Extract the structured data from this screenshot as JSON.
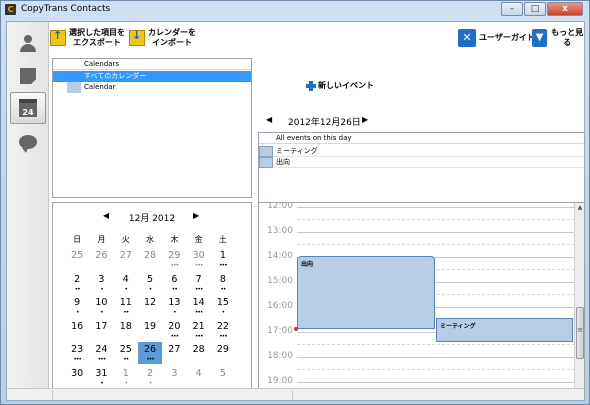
{
  "window": {
    "title": "CopyTrans Contacts",
    "app_icon": "C",
    "buttons": {
      "minimize": "–",
      "maximize": "□",
      "close": "x"
    }
  },
  "sidebar": {
    "items": [
      {
        "name": "contacts",
        "icon": "person-icon"
      },
      {
        "name": "notes",
        "icon": "note-icon"
      },
      {
        "name": "calendar",
        "icon": "calendar-icon",
        "badge": "24",
        "active": true
      },
      {
        "name": "messages",
        "icon": "chat-icon"
      }
    ]
  },
  "toolbar": {
    "export_label_1": "選択した項目を",
    "export_label_2": "エクスポート",
    "import_label_1": "カレンダーを",
    "import_label_2": "インポート",
    "user_guide": "ユーザーガイド",
    "more": "もっと見る"
  },
  "calendar_list": {
    "header": "Calendars",
    "items": [
      {
        "label": "すべてのカレンダー",
        "selected": true
      },
      {
        "label": "Calendar",
        "color": "#b8cce4"
      }
    ]
  },
  "mini_calendar": {
    "prev": "◀",
    "next": "▶",
    "title": "12月 2012",
    "weekdays": [
      "日",
      "月",
      "火",
      "水",
      "木",
      "金",
      "土"
    ],
    "weeks": [
      [
        {
          "d": "25",
          "o": true
        },
        {
          "d": "26",
          "o": true
        },
        {
          "d": "27",
          "o": true
        },
        {
          "d": "28",
          "o": true
        },
        {
          "d": "29",
          "o": true,
          "dots": "•••"
        },
        {
          "d": "30",
          "o": true,
          "dots": "•••"
        },
        {
          "d": "1",
          "dots": "•••"
        }
      ],
      [
        {
          "d": "2",
          "dots": "••"
        },
        {
          "d": "3",
          "dots": "•"
        },
        {
          "d": "4",
          "dots": "•"
        },
        {
          "d": "5",
          "dots": "•"
        },
        {
          "d": "6",
          "dots": "••"
        },
        {
          "d": "7",
          "dots": "•••"
        },
        {
          "d": "8",
          "dots": "••"
        }
      ],
      [
        {
          "d": "9",
          "dots": "•"
        },
        {
          "d": "10",
          "dots": "•"
        },
        {
          "d": "11",
          "dots": "••"
        },
        {
          "d": "12"
        },
        {
          "d": "13",
          "dots": "•"
        },
        {
          "d": "14",
          "dots": "•••"
        },
        {
          "d": "15",
          "dots": "•"
        }
      ],
      [
        {
          "d": "16"
        },
        {
          "d": "17"
        },
        {
          "d": "18"
        },
        {
          "d": "19"
        },
        {
          "d": "20",
          "dots": "•••"
        },
        {
          "d": "21",
          "dots": "•••"
        },
        {
          "d": "22",
          "dots": "•••"
        }
      ],
      [
        {
          "d": "23",
          "dots": "•••"
        },
        {
          "d": "24",
          "dots": "•••"
        },
        {
          "d": "25",
          "dots": "••"
        },
        {
          "d": "26",
          "today": true,
          "dots": "•••"
        },
        {
          "d": "27"
        },
        {
          "d": "28"
        },
        {
          "d": "29"
        }
      ],
      [
        {
          "d": "30"
        },
        {
          "d": "31",
          "dots": "•"
        },
        {
          "d": "1",
          "o": true,
          "dots": "•"
        },
        {
          "d": "2",
          "o": true,
          "dots": "•"
        },
        {
          "d": "3",
          "o": true
        },
        {
          "d": "4",
          "o": true
        },
        {
          "d": "5",
          "o": true
        }
      ]
    ]
  },
  "new_event": "新しいイベント",
  "day_view": {
    "prev": "◀",
    "date": "2012年12月26日",
    "next": "▶",
    "all_day_header": "All events on this day",
    "all_day_events": [
      "ミーティング",
      "出向"
    ],
    "hours": [
      "12:00",
      "13:00",
      "14:00",
      "15:00",
      "16:00",
      "17:00",
      "18:00",
      "19:00"
    ],
    "events": [
      {
        "title": "出向",
        "color": "#b8cce4"
      },
      {
        "title": "ミーティング",
        "color": "#b8cce4"
      }
    ],
    "scroll_grip": "≡"
  }
}
